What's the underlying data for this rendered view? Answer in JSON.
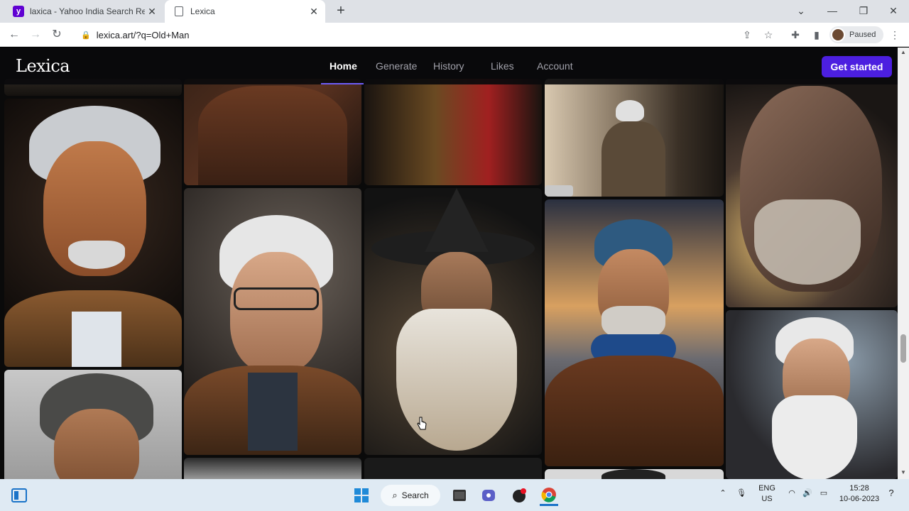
{
  "browser": {
    "tabs": [
      {
        "label": "laxica - Yahoo India Search Resul",
        "favicon": "yahoo-icon",
        "active": false
      },
      {
        "label": "Lexica",
        "favicon": "document-icon",
        "active": true
      }
    ],
    "url": "lexica.art/?q=Old+Man",
    "profile_status": "Paused"
  },
  "site": {
    "logo": "Lexica",
    "nav": [
      {
        "label": "Home",
        "active": true
      },
      {
        "label": "Generate",
        "active": false
      },
      {
        "label": "History",
        "active": false
      },
      {
        "label": "Likes",
        "active": false
      },
      {
        "label": "Account",
        "active": false
      }
    ],
    "cta_label": "Get started",
    "accent": "#4c1fe0"
  },
  "gallery": {
    "subject": "Old Man portraits"
  },
  "taskbar": {
    "search_label": "Search",
    "language": "ENG",
    "region": "US",
    "time": "15:28",
    "date": "10-06-2023"
  }
}
